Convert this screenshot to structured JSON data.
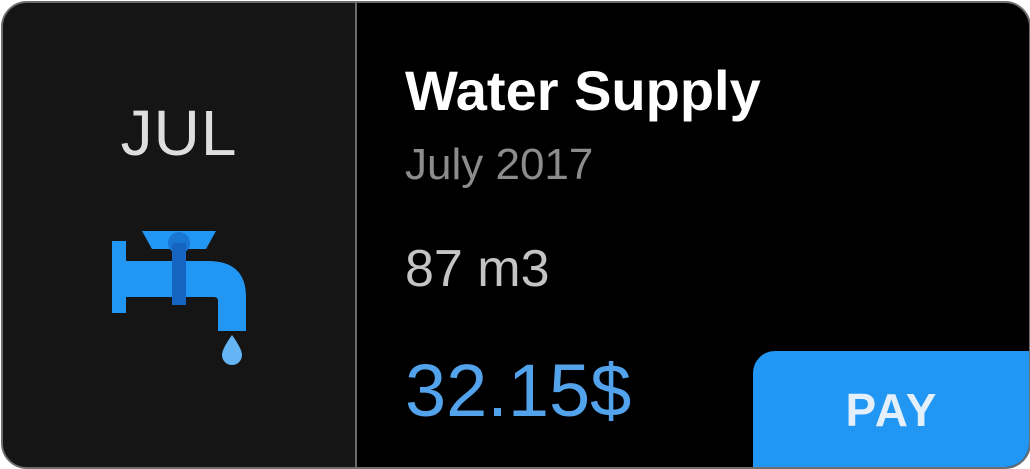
{
  "bill": {
    "month_short": "JUL",
    "icon": "water-tap-icon",
    "title": "Water Supply",
    "period": "July 2017",
    "usage": "87 m3",
    "amount": "32.15$",
    "pay_label": "PAY"
  },
  "colors": {
    "left_panel_bg": "#151515",
    "card_bg": "#000000",
    "accent_blue": "#2196f3",
    "amount_blue": "#52a3ec",
    "tap_dark_blue": "#1565c0",
    "tap_light_blue": "#64b5f6"
  }
}
